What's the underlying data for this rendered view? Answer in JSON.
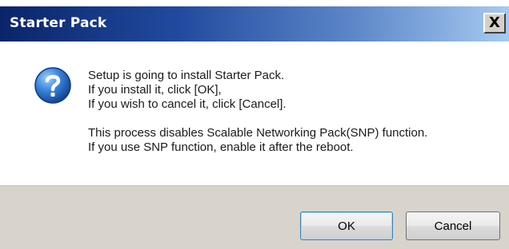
{
  "window": {
    "title": "Starter Pack",
    "close_label": "X"
  },
  "message": {
    "lines": [
      "Setup is going to install Starter Pack.",
      "If you install it, click [OK],",
      "If you wish to cancel it, click [Cancel].",
      "",
      "This process disables Scalable Networking Pack(SNP) function.",
      "If you use SNP function, enable it after the reboot."
    ],
    "icon": "question-icon"
  },
  "buttons": {
    "ok_label": "OK",
    "cancel_label": "Cancel"
  },
  "colors": {
    "titlebar_start": "#0a246a",
    "titlebar_end": "#a6caf0",
    "footer_bg": "#d8d4cc",
    "icon_blue": "#1f5fb5"
  }
}
